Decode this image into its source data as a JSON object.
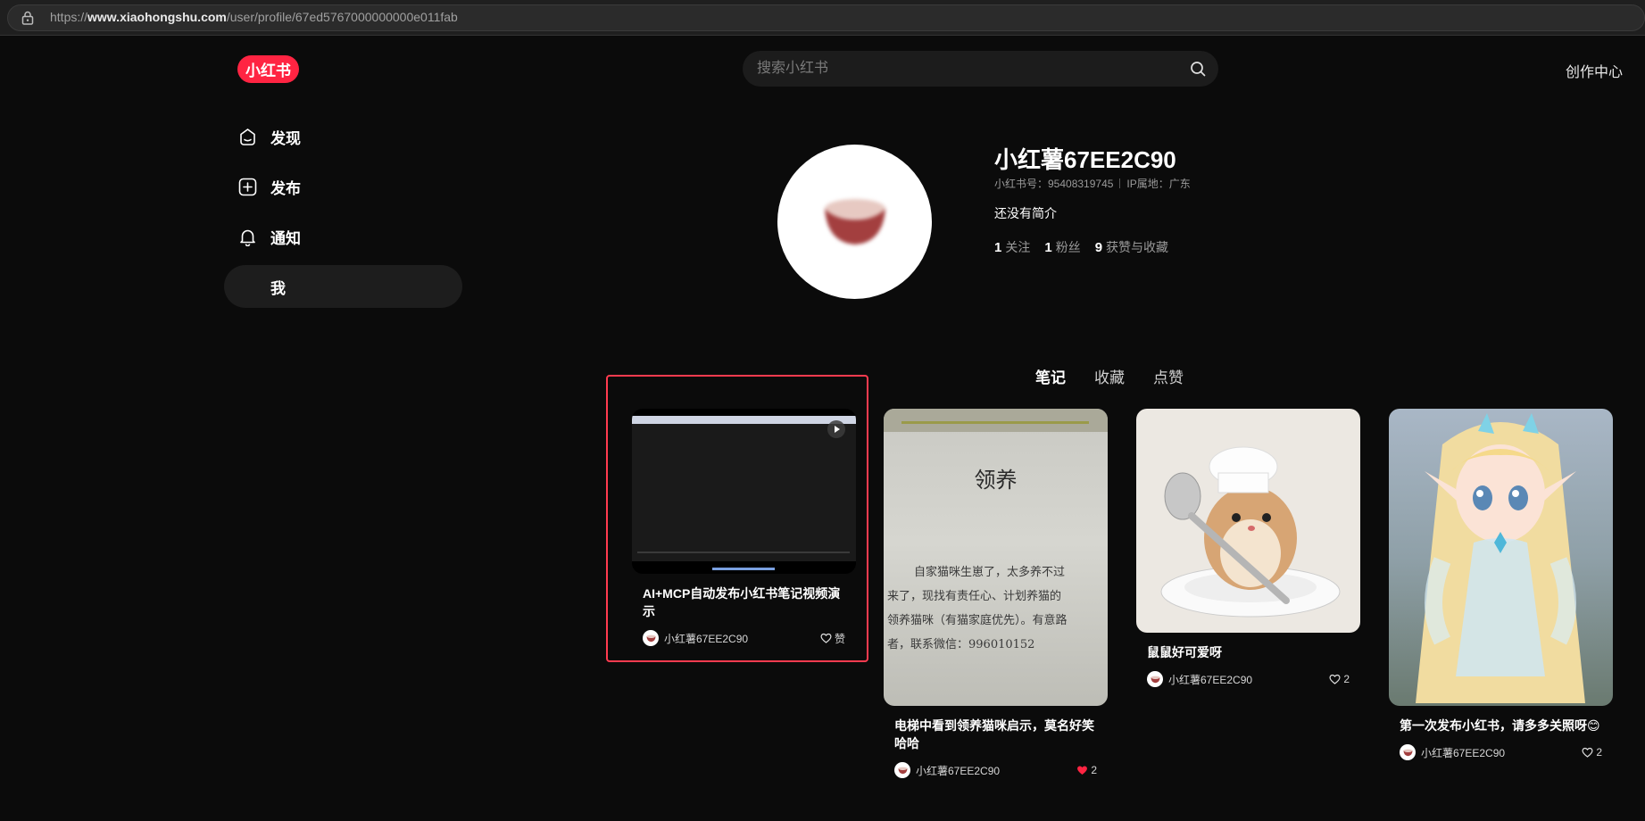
{
  "browser": {
    "url_prefix": "https://",
    "url_domain": "www.xiaohongshu.com",
    "url_path": "/user/profile/67ed5767000000000e011fab"
  },
  "header": {
    "logo_text": "小红书",
    "search_placeholder": "搜索小红书",
    "creator_link": "创作中心"
  },
  "sidebar": {
    "items": [
      {
        "label": "发现",
        "icon": "discover-icon"
      },
      {
        "label": "发布",
        "icon": "publish-icon"
      },
      {
        "label": "通知",
        "icon": "bell-icon"
      },
      {
        "label": "我",
        "icon": "none",
        "active": true
      }
    ]
  },
  "profile": {
    "nickname": "小红薯67EE2C90",
    "red_id": "小红书号：95408319745",
    "ip_location": "IP属地：广东",
    "bio": "还没有简介",
    "stats": [
      {
        "num": "1",
        "label": "关注"
      },
      {
        "num": "1",
        "label": "粉丝"
      },
      {
        "num": "9",
        "label": "获赞与收藏"
      }
    ]
  },
  "tabs": [
    {
      "label": "笔记",
      "active": true
    },
    {
      "label": "收藏",
      "active": false
    },
    {
      "label": "点赞",
      "active": false
    }
  ],
  "notes": [
    {
      "title": "AI+MCP自动发布小红书笔记视频演示",
      "author": "小红薯67EE2C90",
      "likes": "赞",
      "liked": false,
      "video": true
    },
    {
      "title": "电梯中看到领养猫咪启示，莫名好笑哈哈",
      "author": "小红薯67EE2C90",
      "likes": "2",
      "liked": true,
      "cover_heading": "领养",
      "cover_lines": [
        "自家猫咪生崽了，太多养不过",
        "来了，现找有责任心、计划养猫的",
        "领养猫咪（有猫家庭优先）。有意路",
        "者，联系微信：996010152"
      ]
    },
    {
      "title": "鼠鼠好可爱呀",
      "author": "小红薯67EE2C90",
      "likes": "2",
      "liked": false
    },
    {
      "title": "第一次发布小红书，请多多关照呀😊",
      "author": "小红薯67EE2C90",
      "likes": "2",
      "liked": false
    }
  ],
  "colors": {
    "brand": "#ff2442",
    "liked": "#ff2442",
    "highlight": "#ff3b4f"
  }
}
